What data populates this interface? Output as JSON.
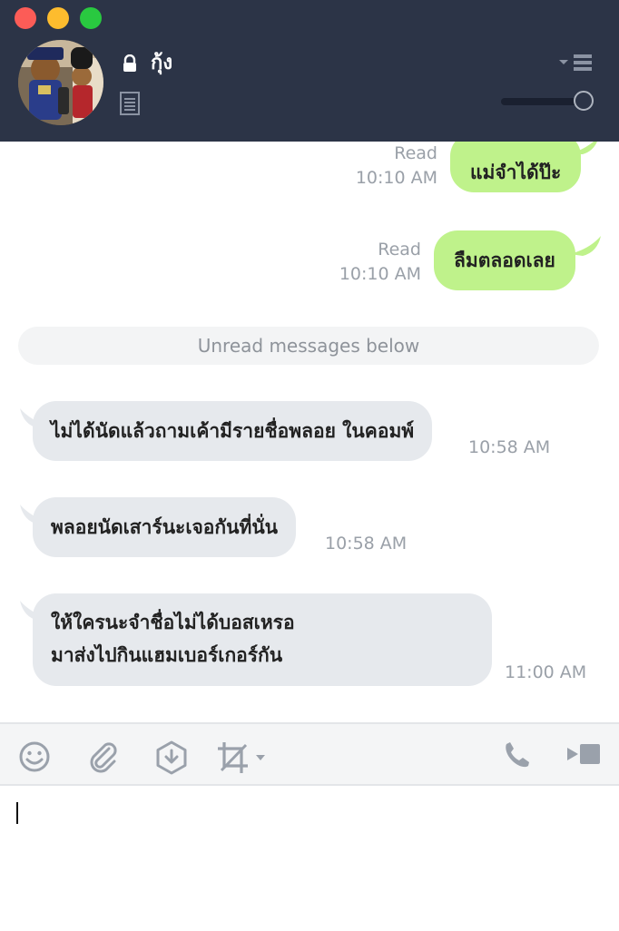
{
  "window": {
    "controls": [
      "close",
      "minimize",
      "maximize"
    ]
  },
  "header": {
    "chat_name": "กุ้ง",
    "lock_icon": "lock-icon",
    "note_icon": "note-icon",
    "menu_icon": "dropdown-menu-icon",
    "avatar": "profile-photo",
    "transparency_slider": {
      "value": 1.0
    }
  },
  "messages": [
    {
      "direction": "out",
      "text": "แม่จำได้ป๊ะ",
      "status": "Read",
      "time": "10:10 AM"
    },
    {
      "direction": "out",
      "text": "ลืมตลอดเลย",
      "status": "Read",
      "time": "10:10 AM"
    },
    {
      "direction": "in",
      "text": "ไม่ได้นัดแล้วถามเค้ามีรายชื่อพลอย ในคอมพ์",
      "time": "10:58 AM"
    },
    {
      "direction": "in",
      "text": "พลอยนัดเสาร์นะเจอกันที่นั่น",
      "time": "10:58 AM"
    },
    {
      "direction": "in",
      "lines": [
        "ให้ใครนะจำชื่อไม่ได้บอสเหรอ",
        "มาส่งไปกินแฮมเบอร์เกอร์กัน"
      ],
      "time": "11:00 AM"
    }
  ],
  "unread_divider": "Unread messages below",
  "toolbar": {
    "icons": [
      "emoji-icon",
      "attach-icon",
      "download-icon",
      "crop-icon",
      "call-icon",
      "video-call-icon"
    ]
  },
  "input": {
    "value": ""
  },
  "colors": {
    "header_bg": "#2c3447",
    "outgoing_bubble": "#bff28b",
    "incoming_bubble": "#e6e9ed",
    "meta_text": "#9aa0a8"
  }
}
